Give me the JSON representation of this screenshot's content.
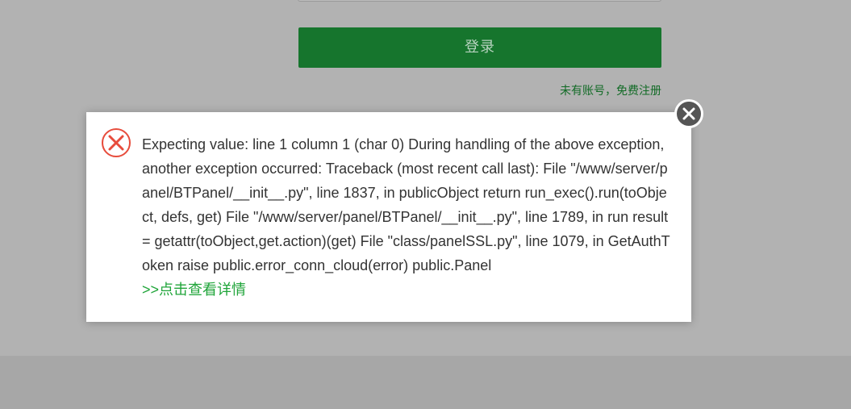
{
  "login_form": {
    "login_button_label": "登录",
    "register_link_label": "未有账号，免费注册"
  },
  "error_dialog": {
    "icon": "error-x-icon",
    "message": "Expecting value: line 1 column 1 (char 0) During handling of the above exception, another exception occurred: Traceback (most recent call last): File \"/www/server/panel/BTPanel/__init__.py\", line 1837, in publicObject return run_exec().run(toObject, defs, get) File \"/www/server/panel/BTPanel/__init__.py\", line 1789, in run result = getattr(toObject,get.action)(get) File \"class/panelSSL.py\", line 1079, in GetAuthToken raise public.error_conn_cloud(error) public.Panel",
    "details_link_label": ">>点击查看详情",
    "close_icon": "close-icon"
  },
  "colors": {
    "overlay": "#b2b2b2",
    "login_button": "#16752d",
    "register_link": "#126b26",
    "error_icon": "#e74c3c",
    "details_link": "#20a53a",
    "close_button": "#555555"
  }
}
